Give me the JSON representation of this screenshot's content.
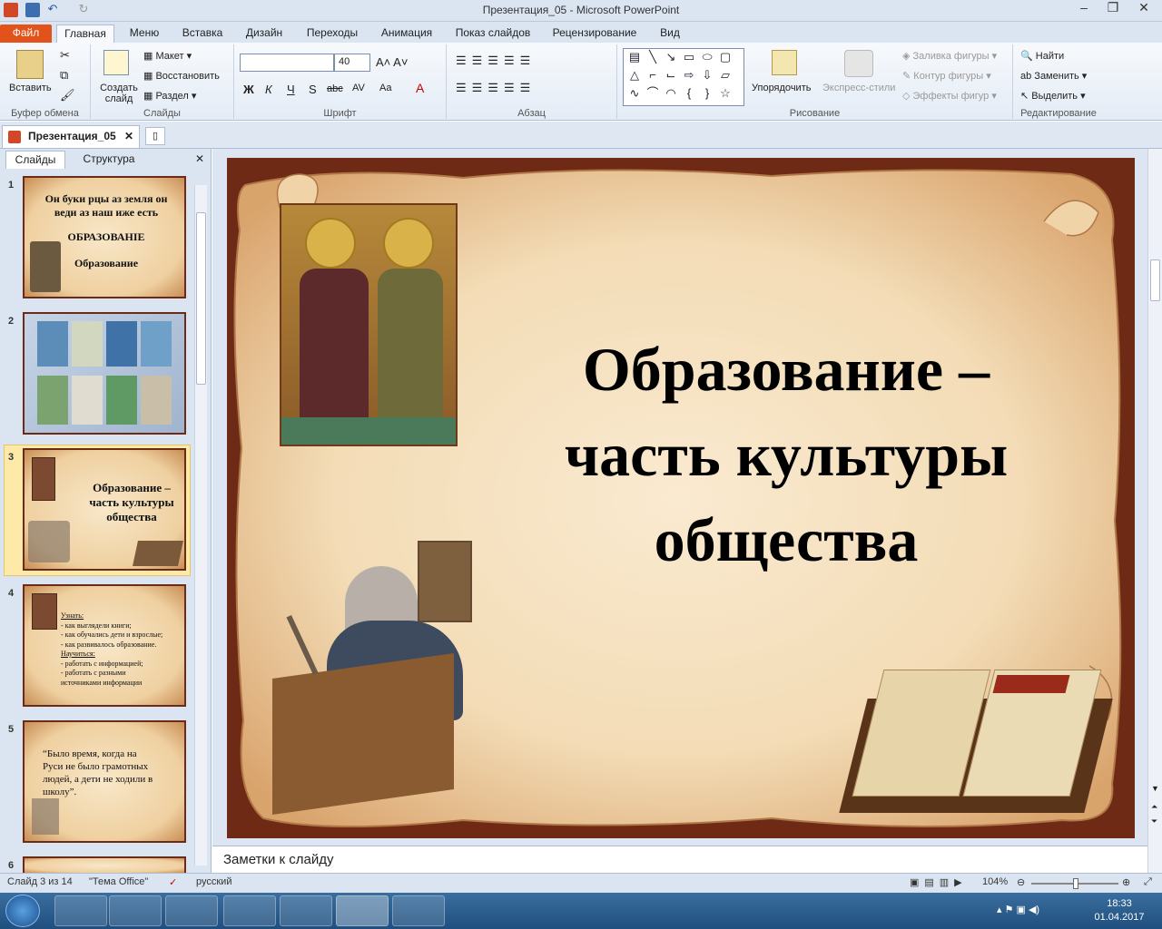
{
  "window": {
    "title": "Презентация_05  -  Microsoft PowerPoint"
  },
  "ribbon_tabs": [
    "Файл",
    "Главная",
    "Меню",
    "Вставка",
    "Дизайн",
    "Переходы",
    "Анимация",
    "Показ слайдов",
    "Рецензирование",
    "Вид"
  ],
  "ribbon": {
    "clipboard": {
      "paste": "Вставить",
      "label": "Буфер обмена"
    },
    "slides": {
      "create": "Создать слайд",
      "layout": "Макет",
      "reset": "Восстановить",
      "section": "Раздел",
      "label": "Слайды"
    },
    "font": {
      "size": "40",
      "label": "Шрифт",
      "bold": "Ж",
      "italic": "К",
      "underline": "Ч",
      "shadow": "S",
      "strike": "abc",
      "spacing": "AV",
      "case": "Aa",
      "color": "A"
    },
    "paragraph": {
      "label": "Абзац"
    },
    "drawing": {
      "arrange": "Упорядочить",
      "styles": "Экспресс-стили",
      "fill": "Заливка фигуры",
      "outline": "Контур фигуры",
      "effects": "Эффекты фигур",
      "label": "Рисование"
    },
    "editing": {
      "find": "Найти",
      "replace": "Заменить",
      "select": "Выделить",
      "label": "Редактирование"
    }
  },
  "document_tab": "Презентация_05",
  "panel_tabs": {
    "slides": "Слайды",
    "outline": "Структура"
  },
  "thumbnails": [
    {
      "num": "1",
      "lines": [
        "Он буки рцы аз земля он",
        "веди аз наш иже есть",
        "",
        "ОБРАЗОВАНIЕ",
        "",
        "Образование"
      ]
    },
    {
      "num": "2",
      "lines": []
    },
    {
      "num": "3",
      "lines": [
        "Образование –",
        "часть культуры",
        "общества"
      ]
    },
    {
      "num": "4",
      "lines": [
        "Узнать:",
        "- как выглядели книги;",
        "- как обучались дети и взрослые;",
        "- как развивалось образование.",
        "Научиться:",
        "- работать с информацией;",
        "- работать с разными",
        "источниками информации"
      ]
    },
    {
      "num": "5",
      "lines": [
        "“Было время, когда на",
        "Руси не было грамотных",
        "людей, а дети не ходили  в",
        "школу”."
      ]
    },
    {
      "num": "6",
      "lines": []
    }
  ],
  "slide": {
    "title_lines": [
      "Образование –",
      "часть культуры",
      "общества"
    ]
  },
  "notes_placeholder": "Заметки к слайду",
  "status": {
    "slide_info": "Слайд 3 из 14",
    "theme": "\"Тема Office\"",
    "language": "русский",
    "zoom": "104%"
  },
  "tray": {
    "time": "18:33",
    "date": "01.04.2017"
  },
  "colors": {
    "accent": "#e1531a",
    "slide_border": "#6e2a14",
    "parchment": "#f3dcb6"
  }
}
